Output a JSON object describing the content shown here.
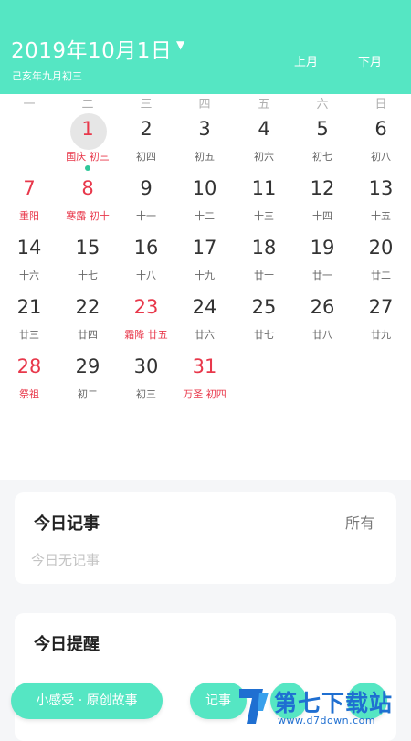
{
  "header": {
    "title": "2019年10月1日",
    "lunar": "己亥年九月初三",
    "prev_label": "上月",
    "next_label": "下月"
  },
  "weekdays": [
    "一",
    "二",
    "三",
    "四",
    "五",
    "六",
    "日"
  ],
  "days": [
    {
      "num": "1",
      "lunar": "国庆 初三",
      "red": true,
      "selected": true,
      "has_event": true
    },
    {
      "num": "2",
      "lunar": "初四"
    },
    {
      "num": "3",
      "lunar": "初五"
    },
    {
      "num": "4",
      "lunar": "初六"
    },
    {
      "num": "5",
      "lunar": "初七"
    },
    {
      "num": "6",
      "lunar": "初八"
    },
    {
      "num": "7",
      "lunar": "重阳",
      "red": true
    },
    {
      "num": "8",
      "lunar": "寒露 初十",
      "red": true
    },
    {
      "num": "9",
      "lunar": "十一"
    },
    {
      "num": "10",
      "lunar": "十二"
    },
    {
      "num": "11",
      "lunar": "十三"
    },
    {
      "num": "12",
      "lunar": "十四"
    },
    {
      "num": "13",
      "lunar": "十五"
    },
    {
      "num": "14",
      "lunar": "十六"
    },
    {
      "num": "15",
      "lunar": "十七"
    },
    {
      "num": "16",
      "lunar": "十八"
    },
    {
      "num": "17",
      "lunar": "十九"
    },
    {
      "num": "18",
      "lunar": "廿十"
    },
    {
      "num": "19",
      "lunar": "廿一"
    },
    {
      "num": "20",
      "lunar": "廿二"
    },
    {
      "num": "21",
      "lunar": "廿三"
    },
    {
      "num": "22",
      "lunar": "廿四"
    },
    {
      "num": "23",
      "lunar": "霜降 廿五",
      "red": true,
      "red_num": true
    },
    {
      "num": "24",
      "lunar": "廿六"
    },
    {
      "num": "25",
      "lunar": "廿七"
    },
    {
      "num": "26",
      "lunar": "廿八"
    },
    {
      "num": "27",
      "lunar": "廿九"
    },
    {
      "num": "28",
      "lunar": "祭祖",
      "red": true
    },
    {
      "num": "29",
      "lunar": "初二"
    },
    {
      "num": "30",
      "lunar": "初三"
    },
    {
      "num": "31",
      "lunar": "万圣 初四",
      "red": true
    }
  ],
  "notes_card": {
    "title": "今日记事",
    "all_label": "所有",
    "empty_text": "今日无记事"
  },
  "reminders_card": {
    "title": "今日提醒"
  },
  "bottom_bar": {
    "story_label": "小感受 · 原创故事",
    "note_label": "记事"
  },
  "watermark": {
    "brand": "第七下载站",
    "url": "www.d7down.com"
  },
  "colors": {
    "accent": "#55e6c3",
    "holiday_red": "#e8384b",
    "event_dot": "#2fc79a"
  }
}
